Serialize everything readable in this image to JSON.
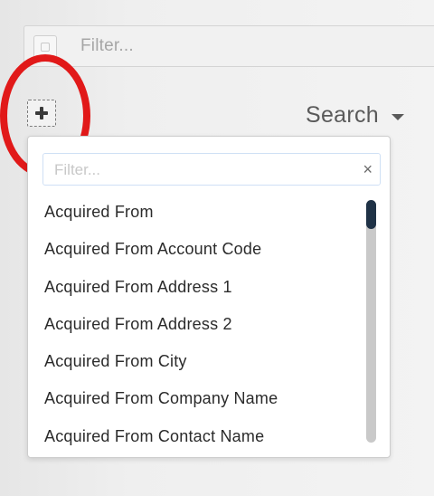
{
  "top_filter": {
    "placeholder": "Filter..."
  },
  "add_button": {
    "icon": "plus-icon"
  },
  "search_dropdown": {
    "label": "Search",
    "icon": "chevron-down-icon"
  },
  "dropdown": {
    "filter_placeholder": "Filter...",
    "clear_glyph": "×",
    "options": [
      "Acquired From",
      "Acquired From Account Code",
      "Acquired From Address 1",
      "Acquired From Address 2",
      "Acquired From City",
      "Acquired From Company Name",
      "Acquired From Contact Name"
    ]
  },
  "colors": {
    "highlight_circle": "#e11919",
    "scroll_thumb": "#1f3246",
    "filter_focus_border": "#cfe0f5"
  }
}
